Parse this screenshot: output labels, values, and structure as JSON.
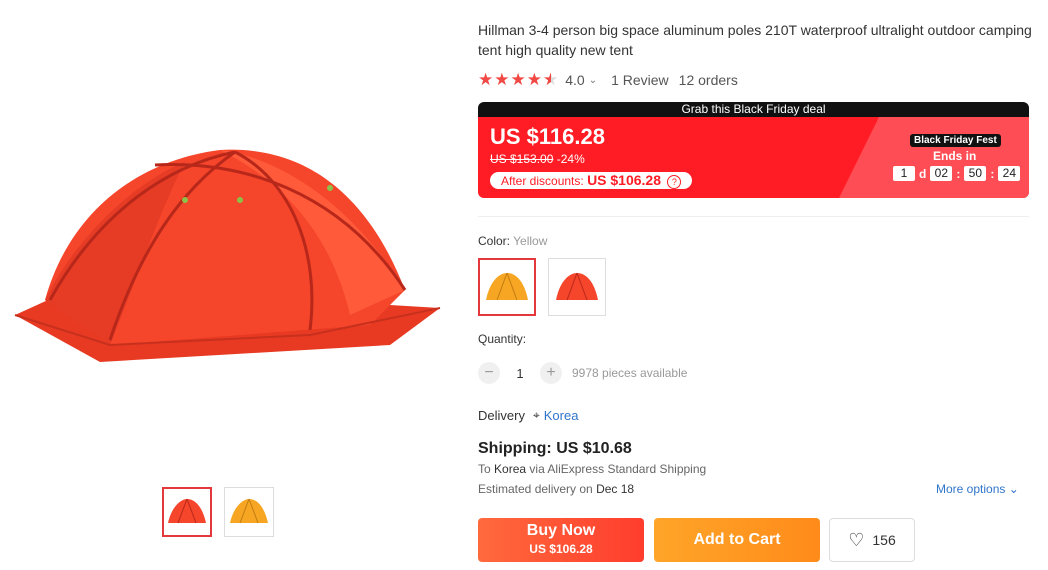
{
  "product": {
    "title": "Hillman 3-4 person big space aluminum poles 210T waterproof ultralight outdoor camping tent high quality new tent",
    "rating": "4.0",
    "rating_value": 4.0,
    "reviews": "1 Review",
    "orders": "12 orders"
  },
  "deal": {
    "header": "Grab this Black Friday deal",
    "price": "US $116.28",
    "old_price": "US $153.00",
    "discount": "-24%",
    "after_label": "After discounts:",
    "after_value": "US $106.28",
    "fest_badge": "Black Friday Fest",
    "ends_label": "Ends in",
    "days": "1",
    "days_unit": "d",
    "hours": "02",
    "minutes": "50",
    "seconds": "24"
  },
  "color": {
    "label": "Color:",
    "value": "Yellow"
  },
  "quantity": {
    "label": "Quantity:",
    "value": "1",
    "minus": "−",
    "plus": "+",
    "available": "9978 pieces available"
  },
  "delivery": {
    "label": "Delivery",
    "country": "Korea"
  },
  "shipping": {
    "title": "Shipping: US $10.68",
    "to_prefix": "To",
    "to_country": "Korea",
    "via_prefix": "via",
    "method": "AliExpress Standard Shipping",
    "est_prefix": "Estimated delivery on",
    "est_date": "Dec 18",
    "more_options": "More options"
  },
  "actions": {
    "buy_now": "Buy Now",
    "buy_price": "US $106.28",
    "add_to_cart": "Add to Cart",
    "wishlist_count": "156"
  },
  "colors": {
    "accent": "#ff1c25",
    "link": "#3075c9",
    "tent_red": "#f5452b",
    "tent_yellow": "#f6a623"
  }
}
